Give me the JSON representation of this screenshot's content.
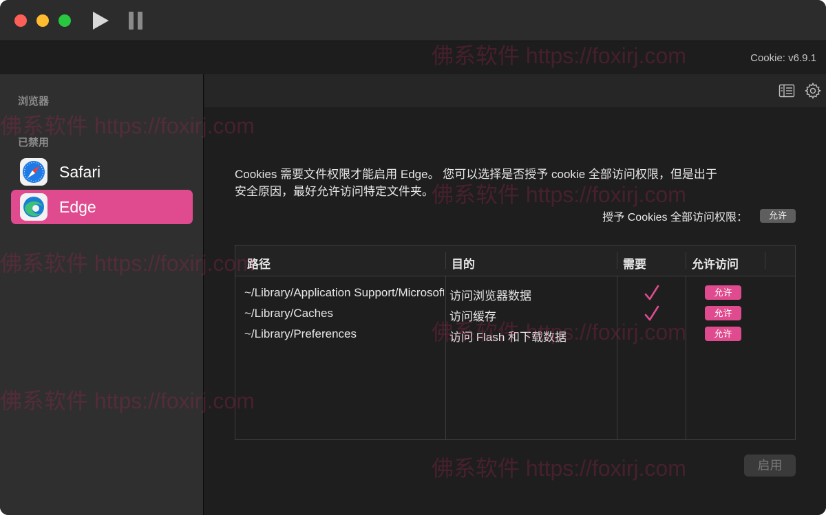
{
  "titlebar": {
    "play_icon": "play-icon",
    "pause_icon": "pause-icon"
  },
  "version": "Cookie: v6.9.1",
  "sidebar": {
    "section_browsers": "浏览器",
    "section_disabled": "已禁用",
    "items": [
      {
        "label": "Safari",
        "icon": "safari-icon",
        "active": false
      },
      {
        "label": "Edge",
        "icon": "edge-icon",
        "active": true
      }
    ]
  },
  "main": {
    "description_line1": "Cookies 需要文件权限才能启用 Edge。 您可以选择是否授予 cookie 全部访问权限，但是出于",
    "description_line2": "安全原因，最好允许访问特定文件夹。",
    "grant_label": "授予 Cookies 全部访问权限：",
    "grant_button": "允许",
    "table": {
      "headers": [
        "路径",
        "目的",
        "需要",
        "允许访问"
      ],
      "rows": [
        {
          "path": "~/Library/Application Support/Microsoft Edge",
          "purpose": "访问浏览器数据",
          "required": true,
          "button": "允许"
        },
        {
          "path": "~/Library/Caches",
          "purpose": "访问缓存",
          "required": true,
          "button": "允许"
        },
        {
          "path": "~/Library/Preferences",
          "purpose": "访问 Flash 和下载数据",
          "required": false,
          "button": "允许"
        }
      ]
    },
    "enable_button": "启用"
  },
  "watermark": "佛系软件 https://foxirj.com",
  "colors": {
    "accent": "#df4b8e",
    "sidebar_bg": "#2f2f2f",
    "main_bg": "#1e1e1e"
  }
}
